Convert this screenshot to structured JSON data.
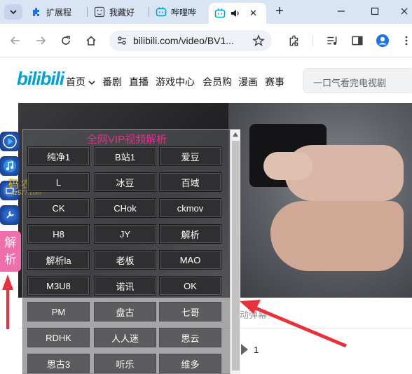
{
  "browser": {
    "tabs": [
      {
        "label": "扩展程",
        "icon": "puzzle-icon"
      },
      {
        "label": "我藏好",
        "icon": "face-icon"
      },
      {
        "label": "哔哩哔",
        "icon": "bilibili-tv-icon"
      },
      {
        "label": "",
        "icon": "bilibili-tv-icon",
        "active": true,
        "close": "✕"
      }
    ],
    "new_tab": "+",
    "address": "bilibili.com/video/BV1...",
    "colors": {
      "tabstrip": "#d9e4f5",
      "accent": "#1a73e8"
    }
  },
  "site": {
    "logo": "bilibili",
    "nav": [
      "首页",
      "番剧",
      "直播",
      "游戏中心",
      "会员购",
      "漫画",
      "赛事"
    ],
    "search_placeholder": "一口气看完电视剧",
    "danmu_hint": "动弹幕",
    "episode_num": "1",
    "brand_color": "#00a1d6"
  },
  "overlay": {
    "watermark": "码农之家",
    "watermark_sub": "xz577.com",
    "parse_tab": [
      "解",
      "析"
    ],
    "panel_title": "全网VIP视频解析",
    "title_color": "#e0318a",
    "buttons": [
      "纯净1",
      "B站1",
      "爱豆",
      "L",
      "冰豆",
      "百域",
      "CK",
      "CHok",
      "ckmov",
      "H8",
      "JY",
      "解析",
      "解析la",
      "老板",
      "MAO",
      "M3U8",
      "诺讯",
      "OK",
      "PM",
      "盘古",
      "七哥",
      "RDHK",
      "人人迷",
      "思云",
      "思古3",
      "听乐",
      "维多"
    ]
  }
}
